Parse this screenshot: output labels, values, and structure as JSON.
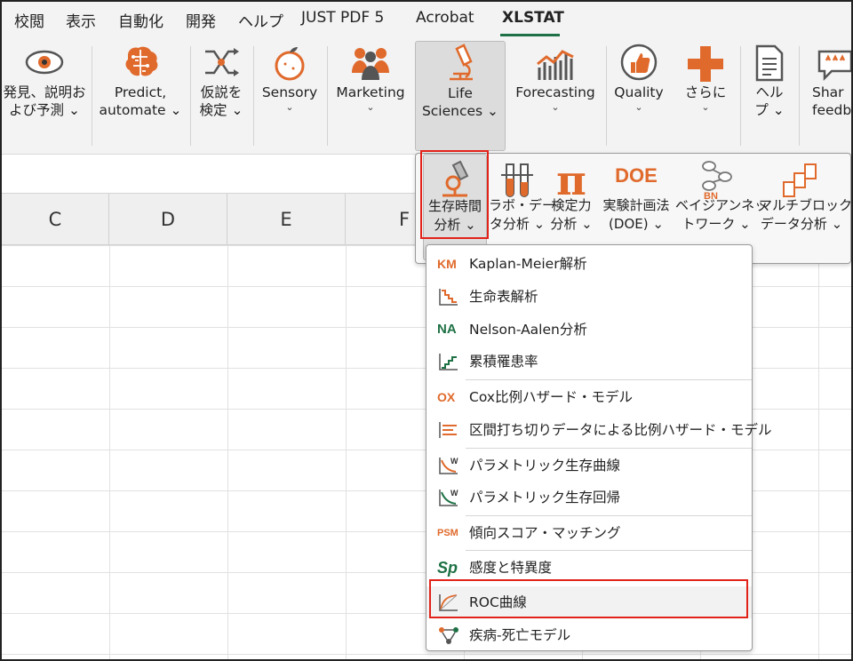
{
  "menu_tabs": [
    "校閲",
    "表示",
    "自動化",
    "開発",
    "ヘルプ",
    "JUST PDF 5",
    "Acrobat",
    "XLSTAT"
  ],
  "active_tab": "XLSTAT",
  "accent": "#1e7145",
  "icon_orange": "#e06a2c",
  "highlight": "#e2231a",
  "ribbon": {
    "describe": {
      "line1": "発見、説明お",
      "line2": "よび予測"
    },
    "predict": {
      "line1": "Predict,",
      "line2": "automate"
    },
    "test": {
      "line1": "仮説を",
      "line2": "検定"
    },
    "sensory": {
      "line1": "Sensory"
    },
    "marketing": {
      "line1": "Marketing"
    },
    "life": {
      "line1": "Life",
      "line2": "Sciences"
    },
    "forecasting": {
      "line1": "Forecasting"
    },
    "quality": {
      "line1": "Quality"
    },
    "more": {
      "line1": "さらに"
    },
    "help": {
      "line1": "ヘル",
      "line2": "プ"
    },
    "share": {
      "line1": "Shar",
      "line2": "feedba"
    }
  },
  "columns": [
    "C",
    "D",
    "E",
    "F"
  ],
  "subribbon": {
    "survival": {
      "line1": "生存時間",
      "line2": "分析"
    },
    "lab": {
      "line1": "ラボ・デー",
      "line2": "タ分析"
    },
    "power": {
      "line1": "検定力",
      "line2": "分析"
    },
    "doe": {
      "line1": "実験計画法",
      "line2": "(DOE)",
      "icon_text": "DOE"
    },
    "bn": {
      "line1": "ベイジアンネッ",
      "line2": "トワーク",
      "icon_text": "BN"
    },
    "multiblock": {
      "line1": "マルチブロック・",
      "line2": "データ分析"
    }
  },
  "menu": {
    "km": {
      "label": "Kaplan-Meier解析",
      "icon_text": "KM"
    },
    "lifetable": {
      "label": "生命表解析"
    },
    "na": {
      "label": "Nelson-Aalen分析",
      "icon_text": "NA"
    },
    "cumulative": {
      "label": "累積罹患率"
    },
    "cox": {
      "label": "Cox比例ハザード・モデル",
      "icon_text": "OX"
    },
    "interval": {
      "label": "区間打ち切りデータによる比例ハザード・モデル"
    },
    "param_survival": {
      "label": "パラメトリック生存曲線"
    },
    "param_reg": {
      "label": "パラメトリック生存回帰"
    },
    "psm": {
      "label": "傾向スコア・マッチング",
      "icon_text": "PSM"
    },
    "sens": {
      "label": "感度と特異度",
      "icon_text": "Sp"
    },
    "roc": {
      "label": "ROC曲線"
    },
    "illness": {
      "label": "疾病-死亡モデル"
    }
  }
}
